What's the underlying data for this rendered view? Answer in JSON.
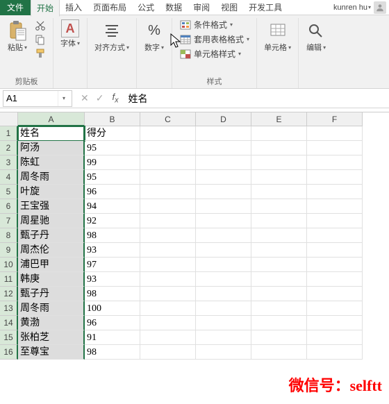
{
  "tabs": {
    "file": "文件",
    "home": "开始",
    "insert": "插入",
    "layout": "页面布局",
    "formula": "公式",
    "data": "数据",
    "review": "审阅",
    "view": "视图",
    "dev": "开发工具"
  },
  "user": {
    "name": "kunren hu"
  },
  "ribbon": {
    "clipboard": {
      "paste": "粘贴",
      "label": "剪贴板"
    },
    "font": {
      "label": "字体",
      "btn": "A"
    },
    "align": {
      "label": "对齐方式"
    },
    "number": {
      "label": "数字",
      "pct": "%"
    },
    "styles": {
      "label": "样式",
      "cond": "条件格式",
      "table": "套用表格格式",
      "cell": "单元格样式"
    },
    "cells": {
      "label": "单元格"
    },
    "edit": {
      "label": "编辑"
    }
  },
  "nameBox": "A1",
  "formula": "姓名",
  "columns": [
    "A",
    "B",
    "C",
    "D",
    "E",
    "F"
  ],
  "grid": [
    {
      "a": "姓名",
      "b": "得分"
    },
    {
      "a": "阿汤",
      "b": "95"
    },
    {
      "a": "陈虹",
      "b": "99"
    },
    {
      "a": "周冬雨",
      "b": "95"
    },
    {
      "a": "叶旋",
      "b": "96"
    },
    {
      "a": "王宝强",
      "b": "94"
    },
    {
      "a": "周星驰",
      "b": "92"
    },
    {
      "a": "甄子丹",
      "b": "98"
    },
    {
      "a": "周杰伦",
      "b": "93"
    },
    {
      "a": "浦巴甲",
      "b": "97"
    },
    {
      "a": "韩庚",
      "b": "93"
    },
    {
      "a": "甄子丹",
      "b": "98"
    },
    {
      "a": "周冬雨",
      "b": "100"
    },
    {
      "a": "黄渤",
      "b": "96"
    },
    {
      "a": "张柏芝",
      "b": "91"
    },
    {
      "a": "至尊宝",
      "b": "98"
    }
  ],
  "watermark": "微信号：selftt"
}
